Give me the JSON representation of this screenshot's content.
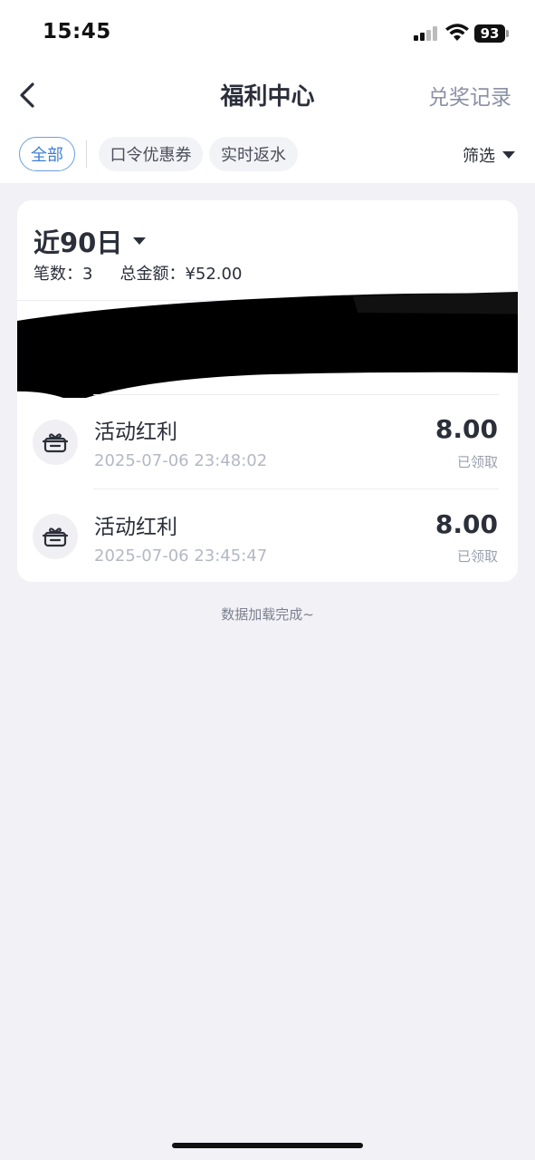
{
  "status_bar": {
    "time": "15:45",
    "battery": "93",
    "icons": [
      "signal-icon",
      "wifi-icon",
      "battery-icon"
    ]
  },
  "nav": {
    "back_icon": "chevron-left-icon",
    "title": "福利中心",
    "right_link": "兑奖记录"
  },
  "tabs": [
    {
      "label": "全部",
      "active": true
    },
    {
      "label": "口令优惠券",
      "active": false
    },
    {
      "label": "实时返水",
      "active": false
    }
  ],
  "filter": {
    "label": "筛选",
    "icon": "caret-down-icon"
  },
  "summary": {
    "period": "近90日",
    "count_label": "笔数：",
    "count": "3",
    "total_label": "总金额：",
    "total": "¥52.00"
  },
  "records": [
    {
      "title": "活动红利",
      "date": "2025-07-06 23:48:02",
      "amount": "8.00",
      "status": "已领取",
      "icon": "gift-box-icon"
    },
    {
      "title": "活动红利",
      "date": "2025-07-06 23:45:47",
      "amount": "8.00",
      "status": "已领取",
      "icon": "gift-box-icon"
    }
  ],
  "footer_text": "数据加载完成~",
  "colors": {
    "accent": "#3d7fd4",
    "background": "#f1f1f6",
    "text": "#2b2f3a",
    "muted": "#b4b8c5"
  }
}
